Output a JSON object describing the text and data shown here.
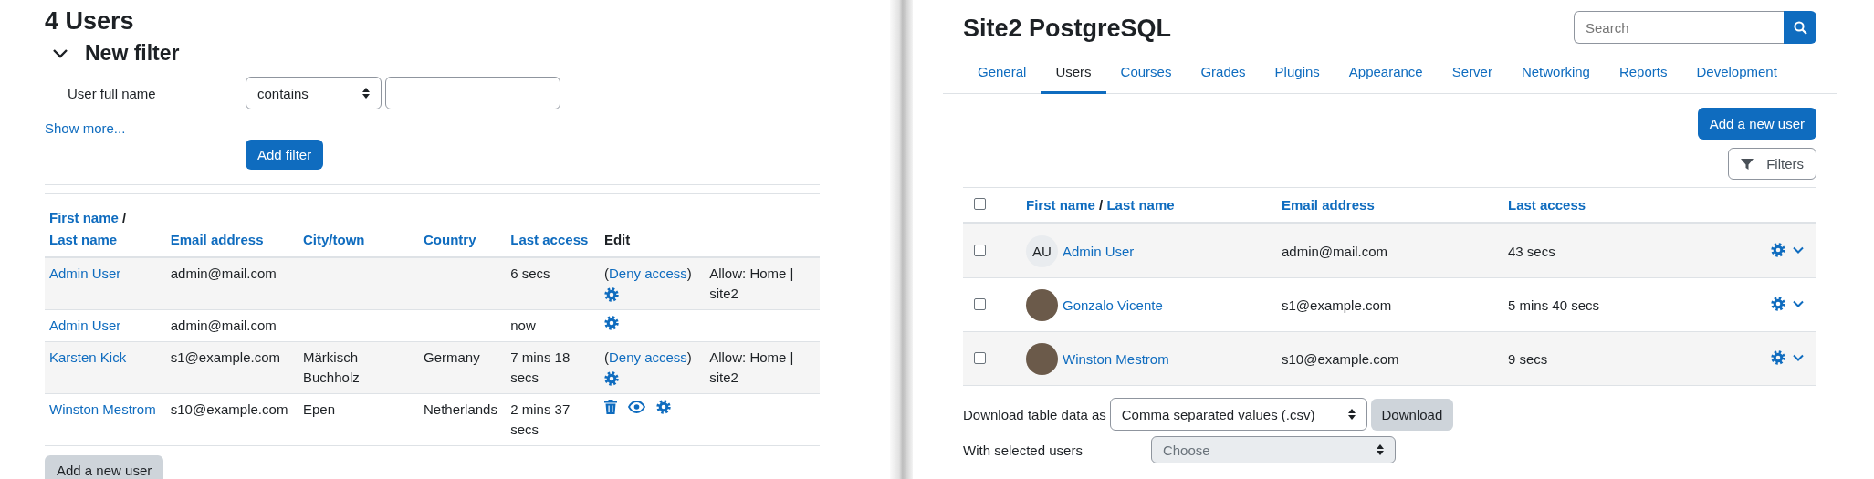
{
  "left": {
    "title": "4 Users",
    "filter": {
      "title": "New filter",
      "expanded": true,
      "field_label": "User full name",
      "operator": "contains",
      "show_more": "Show more...",
      "add_button": "Add filter"
    },
    "table": {
      "name_header": {
        "first": "First name",
        "separator": "/",
        "last": "Last name"
      },
      "columns": [
        {
          "label": "Email address",
          "sortable": true
        },
        {
          "label": "City/town",
          "sortable": true
        },
        {
          "label": "Country",
          "sortable": true
        },
        {
          "label": "Last access",
          "sortable": true
        },
        {
          "label": "Edit",
          "sortable": false
        }
      ],
      "rows": [
        {
          "name": "Admin User",
          "email": "admin@mail.com",
          "last_access": "6 secs",
          "actions": [
            {
              "kind": "link",
              "before": "(",
              "text": "Deny access",
              "after": ")"
            },
            {
              "kind": "settings"
            }
          ],
          "note": "Allow: Home | site2"
        },
        {
          "name": "Admin User",
          "email": "admin@mail.com",
          "last_access": "now",
          "actions": [
            {
              "kind": "settings"
            }
          ]
        },
        {
          "name": "Karsten Kick",
          "email": "s1@example.com",
          "city": "Märkisch Buchholz",
          "country": "Germany",
          "last_access": "7 mins 18 secs",
          "actions": [
            {
              "kind": "link",
              "before": "(",
              "text": "Deny access",
              "after": ")"
            },
            {
              "kind": "settings"
            }
          ],
          "note": "Allow: Home | site2"
        },
        {
          "name": "Winston Mestrom",
          "email": "s10@example.com",
          "city": "Epen",
          "country": "Netherlands",
          "last_access": "2 mins 37 secs",
          "actions": [
            {
              "kind": "delete"
            },
            {
              "kind": "view"
            },
            {
              "kind": "settings"
            }
          ]
        }
      ]
    },
    "add_user_button": "Add a new user"
  },
  "right": {
    "title": "Site2 PostgreSQL",
    "search": {
      "placeholder": "Search"
    },
    "tabs": [
      {
        "label": "General",
        "selected": false
      },
      {
        "label": "Users",
        "selected": true
      },
      {
        "label": "Courses",
        "selected": false
      },
      {
        "label": "Grades",
        "selected": false
      },
      {
        "label": "Plugins",
        "selected": false
      },
      {
        "label": "Appearance",
        "selected": false
      },
      {
        "label": "Server",
        "selected": false
      },
      {
        "label": "Networking",
        "selected": false
      },
      {
        "label": "Reports",
        "selected": false
      },
      {
        "label": "Development",
        "selected": false
      }
    ],
    "add_user_button": "Add a new user",
    "filters_button": "Filters",
    "table": {
      "select_all_checked": false,
      "name_header": {
        "first": "First name",
        "separator": "/",
        "last": "Last name"
      },
      "columns": [
        "Email address",
        "Last access"
      ],
      "rows": [
        {
          "checked": false,
          "avatar": {
            "kind": "initials",
            "text": "AU"
          },
          "name": "Admin User",
          "email": "admin@mail.com",
          "last_access": "43 secs"
        },
        {
          "checked": false,
          "avatar": {
            "kind": "photo"
          },
          "name": "Gonzalo Vicente",
          "email": "s1@example.com",
          "last_access": "5 mins 40 secs"
        },
        {
          "checked": false,
          "avatar": {
            "kind": "photo"
          },
          "name": "Winston Mestrom",
          "email": "s10@example.com",
          "last_access": "9 secs"
        }
      ]
    },
    "download": {
      "label": "Download table data as",
      "format": "Comma separated values (.csv)",
      "button": "Download"
    },
    "bulk": {
      "label": "With selected users",
      "select": "Choose"
    }
  }
}
